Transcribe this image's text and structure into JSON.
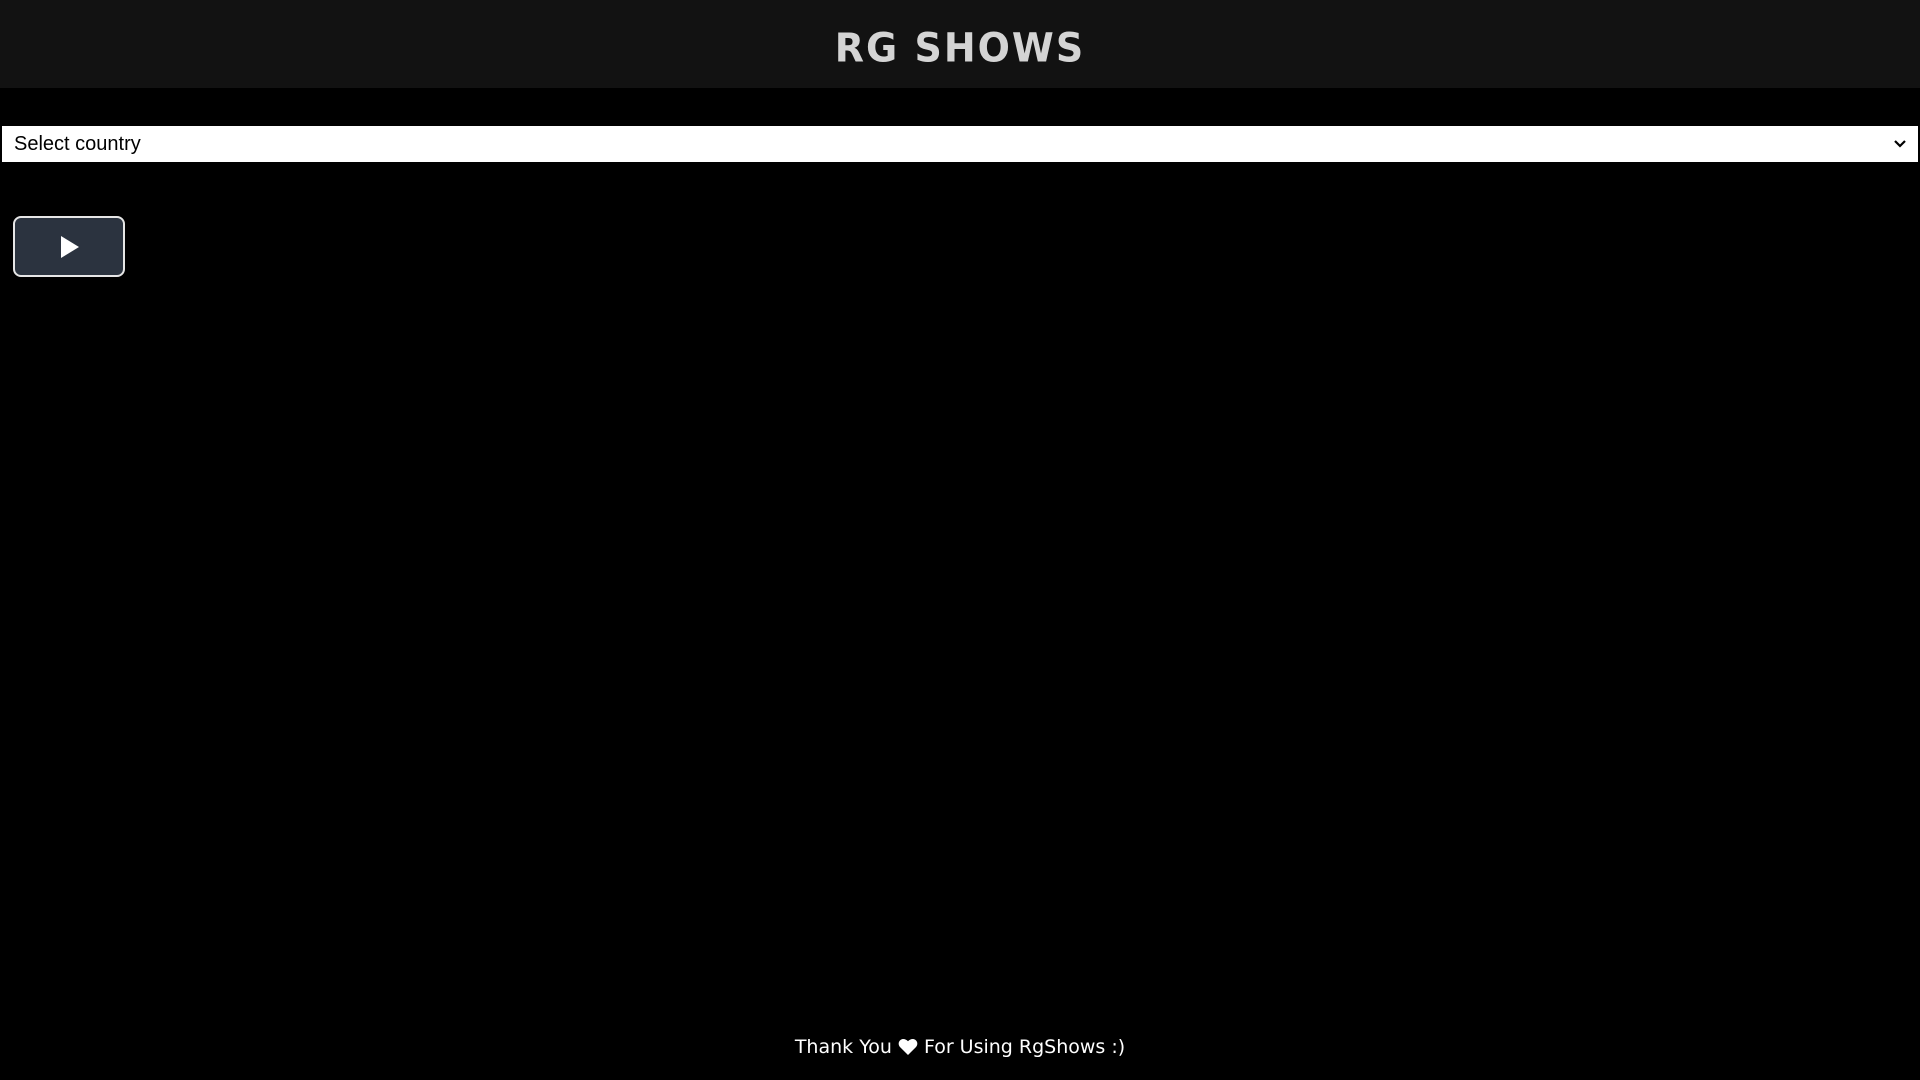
{
  "header": {
    "logo_text": "RG SHOWS"
  },
  "country_select": {
    "selected": "Select country"
  },
  "player": {
    "play_icon": "play-icon"
  },
  "footer": {
    "text_before": "Thank You",
    "heart_icon": "heart-icon",
    "text_after": "For Using RgShows :)"
  },
  "colors": {
    "header_bg": "#121212",
    "page_bg": "#000000",
    "play_button_bg": "#2b333f"
  }
}
